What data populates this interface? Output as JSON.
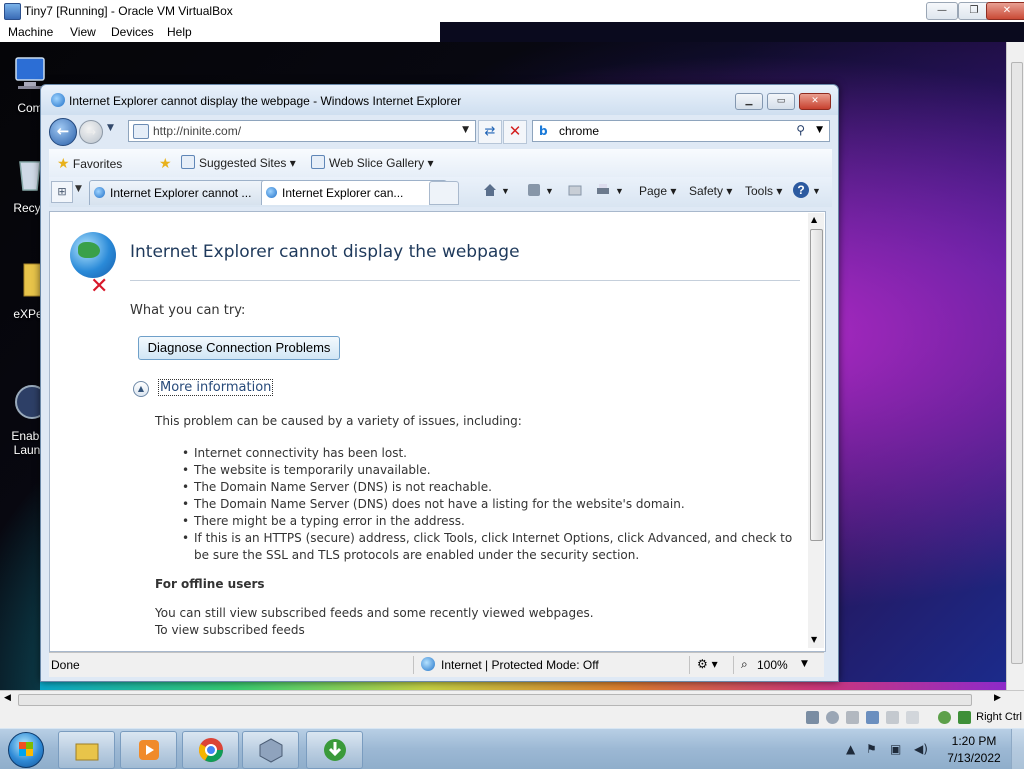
{
  "host": {
    "title": "Tiny7 [Running] - Oracle VM VirtualBox",
    "menus": [
      "Machine",
      "View",
      "Devices",
      "Help"
    ],
    "host_key": "Right Ctrl",
    "window_buttons": {
      "minimize": "—",
      "restore": "❐",
      "close": "✕"
    }
  },
  "desktop": {
    "icons": [
      {
        "label": "Com",
        "icon": "computer-icon"
      },
      {
        "label": "Recyc",
        "icon": "recycle-bin-icon"
      },
      {
        "label": "eXPer",
        "icon": "folder-icon"
      },
      {
        "label": "Enable\nLaunc",
        "icon": "shortcut-icon"
      }
    ]
  },
  "ie": {
    "title": "Internet Explorer cannot display the webpage - Windows Internet Explorer",
    "address": "http://ninite.com/",
    "search_value": "chrome",
    "search_provider_icon": "b",
    "favorites_label": "Favorites",
    "suggested_sites": "Suggested Sites",
    "web_slice_gallery": "Web Slice Gallery",
    "tabs": [
      {
        "label": "Internet Explorer cannot ...",
        "active": false
      },
      {
        "label": "Internet Explorer can...",
        "active": true
      }
    ],
    "commands": {
      "page": "Page",
      "safety": "Safety",
      "tools": "Tools",
      "help": "?"
    },
    "content": {
      "heading": "Internet Explorer cannot display the webpage",
      "try_label": "What you can try:",
      "diagnose_button": "Diagnose Connection Problems",
      "more_info": "More information",
      "cause_intro": "This problem can be caused by a variety of issues, including:",
      "causes": [
        "Internet connectivity has been lost.",
        "The website is temporarily unavailable.",
        "The Domain Name Server (DNS) is not reachable.",
        "The Domain Name Server (DNS) does not have a listing for the website's domain.",
        "There might be a typing error in the address.",
        "If this is an HTTPS (secure) address, click Tools, click Internet Options, click Advanced, and check to be sure the SSL and TLS protocols are enabled under the security section."
      ],
      "offline_heading": "For offline users",
      "offline_text1": "You can still view subscribed feeds and some recently viewed webpages.",
      "offline_text2": "To view subscribed feeds"
    },
    "status": {
      "left": "Done",
      "zone": "Internet | Protected Mode: Off",
      "zoom": "100%"
    }
  },
  "taskbar": {
    "apps": [
      "explorer-icon",
      "media-player-icon",
      "chrome-icon",
      "virtualbox-icon",
      "download-manager-icon"
    ],
    "time": "1:20 PM",
    "date": "7/13/2022"
  },
  "colors": {
    "ie_frame": "#dfe9f5",
    "heading_blue": "#1e395b",
    "link_blue": "#274a7a",
    "close_red": "#c7412f"
  }
}
